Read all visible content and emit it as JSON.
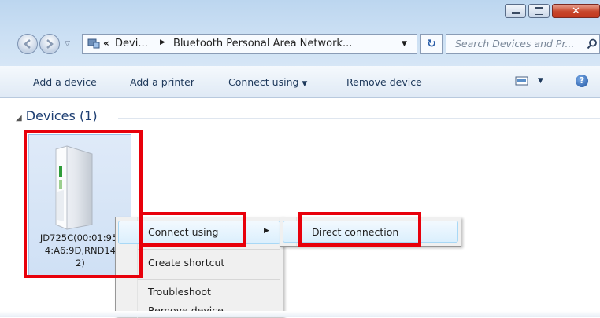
{
  "window": {
    "address": {
      "crumb1": "Devi...",
      "crumb2": "Bluetooth Personal Area Network...",
      "chevron": "«"
    },
    "search_placeholder": "Search Devices and Pr...",
    "icons": [
      "back-icon",
      "forward-icon",
      "refresh-icon",
      "search-icon",
      "minimize-icon",
      "maximize-icon",
      "close-icon"
    ]
  },
  "toolbar": {
    "add_device": "Add a device",
    "add_printer": "Add a printer",
    "connect_using": "Connect using",
    "remove_device": "Remove device"
  },
  "group": {
    "title": "Devices (1)"
  },
  "device": {
    "label_lines": [
      "JD725C(00:01:95:",
      "4:A6:9D,RND14",
      "2)"
    ],
    "icon": "router-device-icon"
  },
  "context_menu": {
    "items": [
      "Connect using",
      "Create shortcut",
      "Troubleshoot",
      "Remove device"
    ]
  },
  "submenu": {
    "items": [
      "Direct connection"
    ]
  },
  "colors": {
    "highlight": "#e8000b",
    "menu_hover": "#dbeffd",
    "tile_selected": "#cfe0f5"
  }
}
